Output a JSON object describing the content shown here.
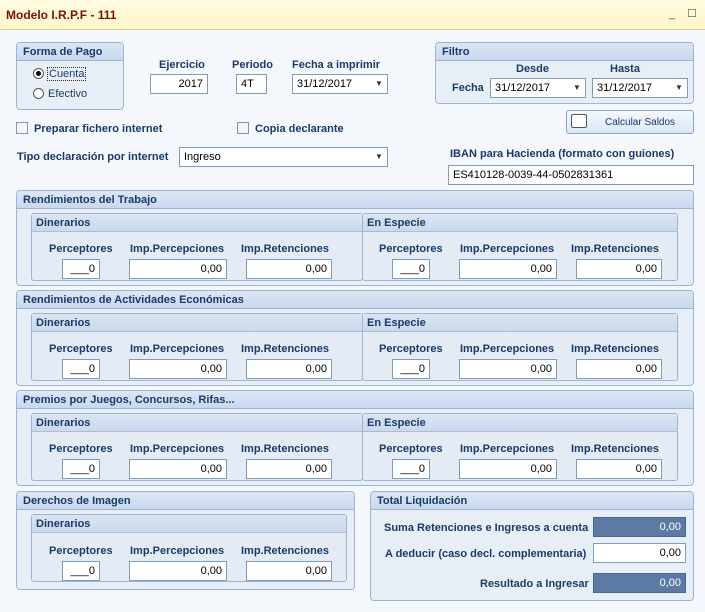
{
  "window": {
    "title": "Modelo I.R.P.F - 111",
    "minimize": "_",
    "maximize": "☐"
  },
  "forma_pago": {
    "title": "Forma de Pago",
    "opt_cuenta": "Cuenta",
    "opt_efectivo": "Efectivo",
    "selected": "Cuenta"
  },
  "ejercicio": {
    "label": "Ejercicio",
    "value": "2017"
  },
  "periodo": {
    "label": "Periodo",
    "value": "4T"
  },
  "fecha_imprimir": {
    "label": "Fecha a imprimir",
    "value": "31/12/2017"
  },
  "filtro": {
    "title": "Filtro",
    "desde_label": "Desde",
    "hasta_label": "Hasta",
    "fecha_label": "Fecha",
    "desde_value": "31/12/2017",
    "hasta_value": "31/12/2017"
  },
  "calcular_saldos": "Calcular Saldos",
  "preparar_fichero": "Preparar fichero internet",
  "copia_declarante": "Copia declarante",
  "tipo_declaracion": {
    "label": "Tipo declaración por internet",
    "value": "Ingreso"
  },
  "iban": {
    "label": "IBAN para Hacienda (formato con guiones)",
    "value": "ES410128-0039-44-0502831361"
  },
  "cols": {
    "perceptores": "Perceptores",
    "imp_percepciones": "Imp.Percepciones",
    "imp_retenciones": "Imp.Retenciones"
  },
  "sub": {
    "dinerarios": "Dinerarios",
    "especie": "En Especie"
  },
  "sections": {
    "trabajo": {
      "title": "Rendimientos del Trabajo",
      "din": {
        "perc": "___0",
        "imp_perc": "0,00",
        "imp_ret": "0,00"
      },
      "esp": {
        "perc": "___0",
        "imp_perc": "0,00",
        "imp_ret": "0,00"
      }
    },
    "actividades": {
      "title": "Rendimientos de Actividades Económicas",
      "din": {
        "perc": "___0",
        "imp_perc": "0,00",
        "imp_ret": "0,00"
      },
      "esp": {
        "perc": "___0",
        "imp_perc": "0,00",
        "imp_ret": "0,00"
      }
    },
    "premios": {
      "title": "Premios por Juegos, Concursos, Rifas...",
      "din": {
        "perc": "___0",
        "imp_perc": "0,00",
        "imp_ret": "0,00"
      },
      "esp": {
        "perc": "___0",
        "imp_perc": "0,00",
        "imp_ret": "0,00"
      }
    },
    "imagen": {
      "title": "Derechos de Imagen",
      "din": {
        "perc": "___0",
        "imp_perc": "0,00",
        "imp_ret": "0,00"
      }
    }
  },
  "total": {
    "title": "Total Liquidación",
    "suma_label": "Suma Retenciones e Ingresos a cuenta",
    "suma_value": "0,00",
    "deducir_label": "A deducir (caso decl. complementaria)",
    "deducir_value": "0,00",
    "resultado_label": "Resultado a Ingresar",
    "resultado_value": "0,00"
  }
}
